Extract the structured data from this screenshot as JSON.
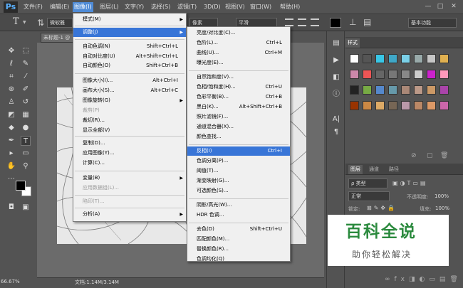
{
  "app": {
    "logo": "Ps"
  },
  "menubar": [
    "文件(F)",
    "编辑(E)",
    "图像(I)",
    "图层(L)",
    "文字(Y)",
    "选择(S)",
    "滤镜(T)",
    "3D(D)",
    "视图(V)",
    "窗口(W)",
    "帮助(H)"
  ],
  "window_controls": {
    "minimize": "—",
    "restore": "□",
    "close": "✕"
  },
  "options_bar": {
    "tool_glyph": "T",
    "font_placeholder": "微软雅",
    "aa_label": "像素",
    "aa_mode": "平滑",
    "workspace": "基本功能"
  },
  "document": {
    "tab_title": "未标题-1 @",
    "zoom": "66.67%",
    "doc_info": "文档:1.14M/3.14M"
  },
  "image_menu": {
    "items": [
      {
        "label": "模式(M)",
        "shortcut": "",
        "submenu": true
      },
      {
        "label": "调整(J)",
        "shortcut": "",
        "submenu": true
      },
      {
        "label": "自动色调(N)",
        "shortcut": "Shift+Ctrl+L"
      },
      {
        "label": "自动对比度(U)",
        "shortcut": "Alt+Shift+Ctrl+L"
      },
      {
        "label": "自动颜色(O)",
        "shortcut": "Shift+Ctrl+B"
      },
      {
        "label": "图像大小(I)...",
        "shortcut": "Alt+Ctrl+I"
      },
      {
        "label": "画布大小(S)...",
        "shortcut": "Alt+Ctrl+C"
      },
      {
        "label": "图像旋转(G)",
        "shortcut": "",
        "submenu": true
      },
      {
        "label": "裁剪(P)",
        "shortcut": "",
        "disabled": true
      },
      {
        "label": "裁切(R)...",
        "shortcut": ""
      },
      {
        "label": "显示全部(V)",
        "shortcut": ""
      },
      {
        "label": "复制(D)...",
        "shortcut": ""
      },
      {
        "label": "应用图像(Y)...",
        "shortcut": ""
      },
      {
        "label": "计算(C)...",
        "shortcut": ""
      },
      {
        "label": "变量(B)",
        "shortcut": "",
        "submenu": true
      },
      {
        "label": "应用数据组(L)...",
        "shortcut": "",
        "disabled": true
      },
      {
        "label": "陷印(T)...",
        "shortcut": "",
        "disabled": true
      },
      {
        "label": "分析(A)",
        "shortcut": "",
        "submenu": true
      }
    ]
  },
  "adjust_menu": {
    "items": [
      {
        "label": "亮度/对比度(C)...",
        "shortcut": ""
      },
      {
        "label": "色阶(L)...",
        "shortcut": "Ctrl+L"
      },
      {
        "label": "曲线(U)...",
        "shortcut": "Ctrl+M"
      },
      {
        "label": "曝光度(E)...",
        "shortcut": ""
      },
      {
        "label": "自然饱和度(V)...",
        "shortcut": ""
      },
      {
        "label": "色相/饱和度(H)...",
        "shortcut": "Ctrl+U"
      },
      {
        "label": "色彩平衡(B)...",
        "shortcut": "Ctrl+B"
      },
      {
        "label": "黑白(K)...",
        "shortcut": "Alt+Shift+Ctrl+B"
      },
      {
        "label": "照片滤镜(F)...",
        "shortcut": ""
      },
      {
        "label": "通道混合器(X)...",
        "shortcut": ""
      },
      {
        "label": "颜色查找...",
        "shortcut": ""
      },
      {
        "label": "反相(I)",
        "shortcut": "Ctrl+I"
      },
      {
        "label": "色调分离(P)...",
        "shortcut": ""
      },
      {
        "label": "阈值(T)...",
        "shortcut": ""
      },
      {
        "label": "渐变映射(G)...",
        "shortcut": ""
      },
      {
        "label": "可选颜色(S)...",
        "shortcut": ""
      },
      {
        "label": "阴影/高光(W)...",
        "shortcut": ""
      },
      {
        "label": "HDR 色调...",
        "shortcut": ""
      },
      {
        "label": "去色(D)",
        "shortcut": "Shift+Ctrl+U"
      },
      {
        "label": "匹配颜色(M)...",
        "shortcut": ""
      },
      {
        "label": "替换颜色(R)...",
        "shortcut": ""
      },
      {
        "label": "色调均化(Q)",
        "shortcut": ""
      }
    ]
  },
  "styles_panel": {
    "tab": "样式"
  },
  "layers_panel": {
    "tabs": [
      "图层",
      "通道",
      "路径"
    ],
    "filter": "ρ 类型",
    "blend_mode": "正常",
    "opacity_label": "不透明度:",
    "opacity": "100%",
    "lock_label": "锁定:",
    "fill_label": "填充:",
    "fill": "100%"
  },
  "watermark": {
    "title": "百科全说",
    "subtitle": "助你轻松解决"
  }
}
